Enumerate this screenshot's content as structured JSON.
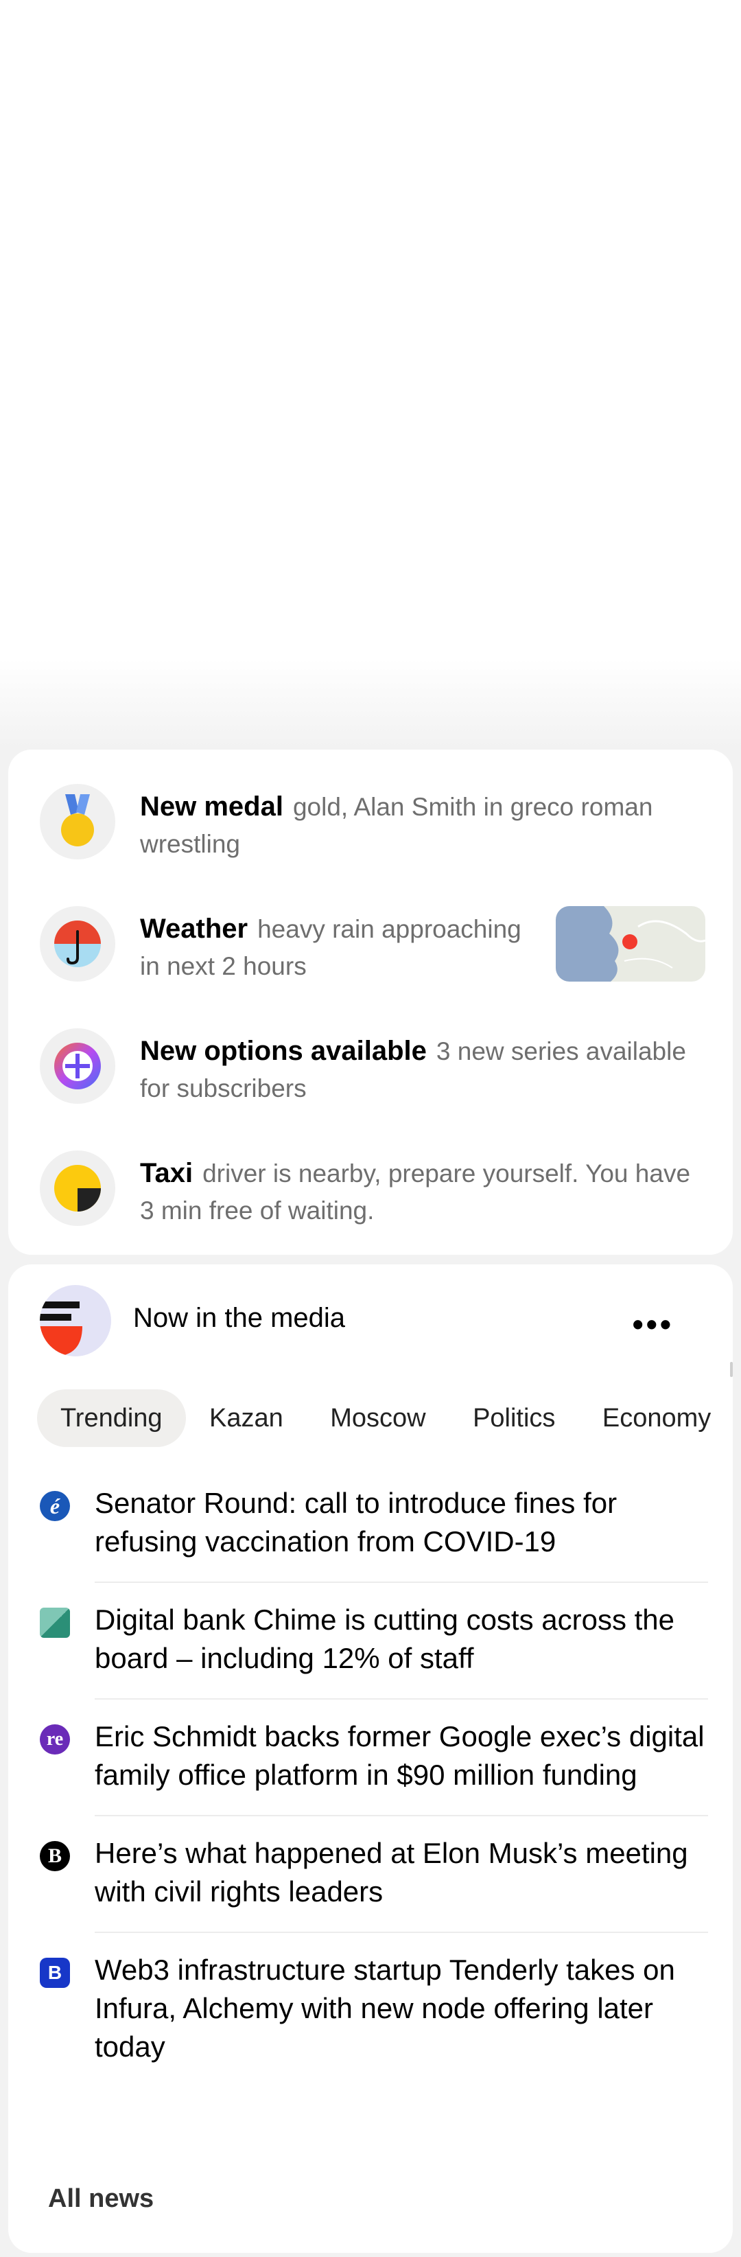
{
  "notifications": [
    {
      "icon": "medal-icon",
      "title": "New medal",
      "text": "gold, Alan Smith in greco roman wrestling"
    },
    {
      "icon": "umbrella-icon",
      "title": "Weather",
      "text": "heavy rain approaching in next 2 hours"
    },
    {
      "icon": "plus-icon",
      "title": "New options available",
      "text": "3 new series available for subscribers"
    },
    {
      "icon": "taxi-icon",
      "title": "Taxi",
      "text": "driver is nearby, prepare yourself. You have 3 min free of waiting."
    }
  ],
  "media": {
    "title": "Now in the media",
    "more_label": "•••",
    "tabs": [
      "Trending",
      "Kazan",
      "Moscow",
      "Politics",
      "Economy"
    ],
    "active_tab": "Trending",
    "news": [
      {
        "source_icon": "source-logo-icon",
        "headline": "Senator Round: call to introduce fines for refusing vaccination from COVID-19"
      },
      {
        "source_icon": "source-logo-icon",
        "headline": "Digital bank Chime is cutting costs across the board – including 12% of staff"
      },
      {
        "source_icon": "source-logo-icon",
        "headline": "Eric Schmidt backs former Google exec’s digital family office platform in $90 million funding"
      },
      {
        "source_icon": "source-logo-icon",
        "headline": "Here’s what happened at Elon Musk’s meeting with civil rights leaders"
      },
      {
        "source_icon": "source-logo-icon",
        "headline": "Web3 infrastructure startup Tenderly takes on Infura, Alchemy with new node offering later today"
      }
    ],
    "all_news_label": "All news"
  }
}
